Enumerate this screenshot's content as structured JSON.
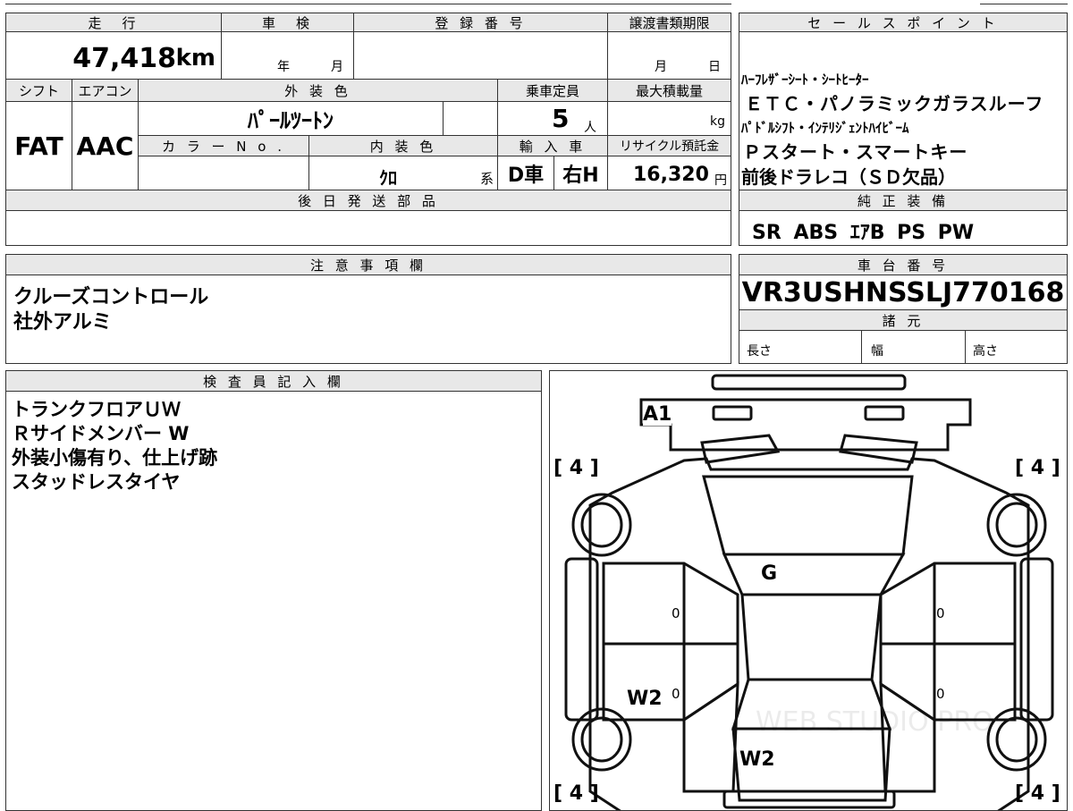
{
  "headers": {
    "mileage": "走　行",
    "inspection": "車　検",
    "registration": "登 録 番 号",
    "transfer_deadline": "譲渡書類期限",
    "sales_point": "セ ー ル ス ポ イ ン ト",
    "shift": "シフト",
    "aircon": "エアコン",
    "exterior_color": "外 装 色",
    "capacity": "乗車定員",
    "max_load": "最大積載量",
    "color_no": "カ ラ ー N o .",
    "interior_color": "内 装 色",
    "import": "輸 入 車",
    "recycle": "リサイクル預託金",
    "later_parts": "後 日 発 送 部 品",
    "genuine_equipment": "純 正 装 備",
    "notes": "注 意 事 項 欄",
    "chassis_number": "車 台 番 号",
    "specs": "諸 元",
    "inspector": "検 査 員 記 入 欄"
  },
  "vehicle": {
    "mileage": "47,418",
    "mileage_unit": "km",
    "inspection_year_label": "年",
    "inspection_month_label": "月",
    "transfer_month_label": "月",
    "transfer_day_label": "日",
    "shift": "FAT",
    "aircon": "AAC",
    "exterior_color": "ﾊﾟｰﾙﾂｰﾄﾝ",
    "capacity": "5",
    "capacity_unit": "人",
    "load_unit": "kg",
    "interior_color": "ｸﾛ",
    "interior_suffix": "系",
    "import_type": "D車",
    "steering": "右H",
    "recycle_fee": "16,320",
    "recycle_unit": "円",
    "chassis_number": "VR3USHNSSLJ770168",
    "length_label": "長さ",
    "width_label": "幅",
    "height_label": "高さ"
  },
  "sales_points": [
    "ﾊｰﾌﾚｻﾞｰｼｰﾄ・ｼｰﾄﾋｰﾀｰ",
    "ＥＴＣ・パノラミックガラスルーフ",
    "ﾊﾟﾄﾞﾙｼﾌﾄ・ｲﾝﾃﾘｼﾞｪﾝﾄﾊｲﾋﾞｰﾑ",
    "Ｐスタート・スマートキー",
    "前後ドラレコ（ＳＤ欠品）"
  ],
  "genuine_equipment": "SR ABS ｴｱB PS PW",
  "notes": [
    "クルーズコントロール",
    "社外アルミ"
  ],
  "inspector_notes": [
    "トランクフロアＵＷ",
    "Ｒサイドメンバー W",
    "外装小傷有り、仕上げ跡",
    "スタッドレスタイヤ"
  ],
  "diagram": {
    "marks": [
      "A1",
      "G",
      "W2",
      "W2"
    ],
    "tire_depth": [
      "4",
      "4",
      "4",
      "4"
    ],
    "tire_bracket_left": "[",
    "tire_bracket_right": "]",
    "zero_marks": [
      "0",
      "0",
      "0",
      "0"
    ],
    "watermark": "WEB STUDIO PRO"
  }
}
